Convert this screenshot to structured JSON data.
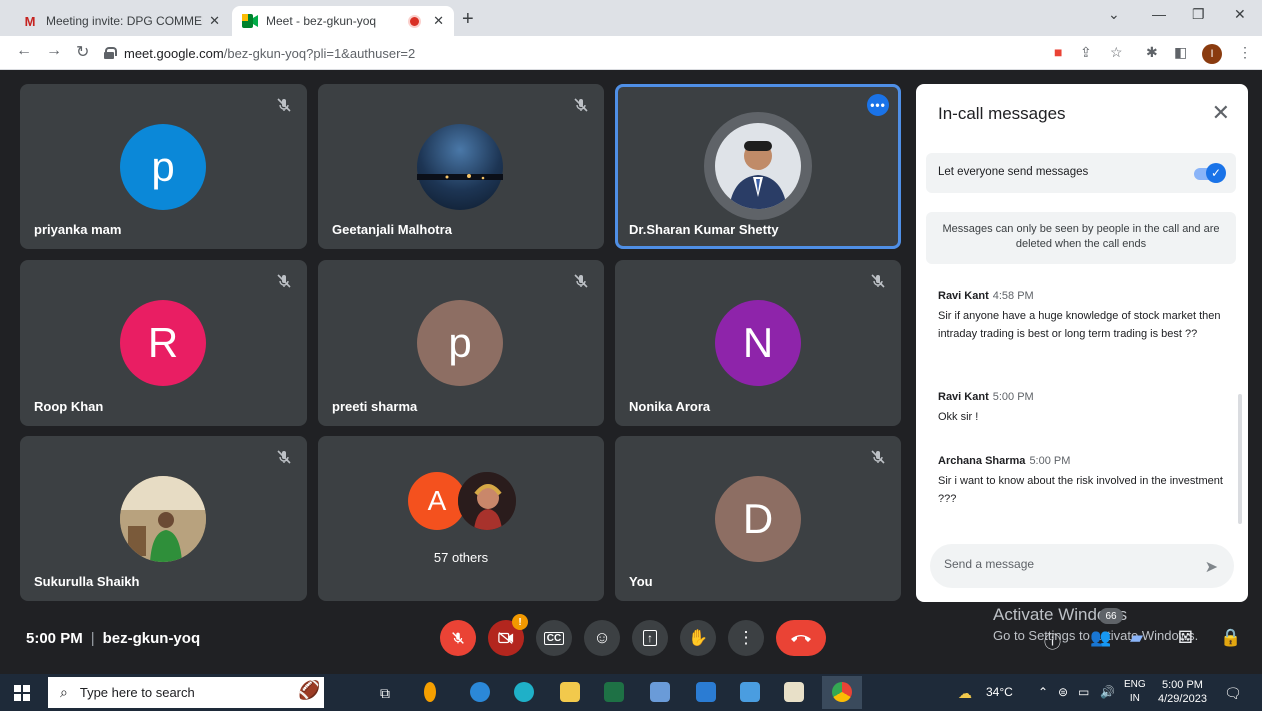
{
  "browser": {
    "tabs": [
      {
        "label": "Meeting invite: DPG COMMERCE",
        "favicon": "gmail-icon"
      },
      {
        "label": "Meet - bez-gkun-yoq",
        "favicon": "meet-icon"
      }
    ],
    "url_host": "meet.google.com",
    "url_path": "/bez-gkun-yoq?pli=1&authuser=2",
    "profile_initial": "I"
  },
  "participants": [
    {
      "name": "priyanka mam",
      "initial": "p",
      "color": "#0b88d8",
      "muted": true
    },
    {
      "name": "Geetanjali Malhotra",
      "initial": "",
      "color": "#2b4a6b",
      "muted": true
    },
    {
      "name": "Dr.Sharan Kumar Shetty",
      "initial": "",
      "color": "#8ca0b3",
      "muted": false,
      "active": true
    },
    {
      "name": "Roop Khan",
      "initial": "R",
      "color": "#e91e63",
      "muted": true
    },
    {
      "name": "preeti sharma",
      "initial": "p",
      "color": "#8d6e63",
      "muted": true
    },
    {
      "name": "Nonika Arora",
      "initial": "N",
      "color": "#8e24aa",
      "muted": true
    },
    {
      "name": "Sukurulla Shaikh",
      "initial": "",
      "color": "#8a7f62",
      "muted": true
    },
    {
      "name": "57 others",
      "initial": "A",
      "color": "#f4511e",
      "muted": false
    },
    {
      "name": "You",
      "initial": "D",
      "color": "#8d6e63",
      "muted": true
    }
  ],
  "chat": {
    "title": "In-call messages",
    "toggle_label": "Let everyone send messages",
    "notice": "Messages can only be seen by people in the call and are deleted when the call ends",
    "messages": [
      {
        "sender": "Ravi Kant",
        "time": "4:58 PM",
        "text": "Sir if anyone have a huge knowledge of stock market then intraday trading is best or long term trading is best ??"
      },
      {
        "sender": "Ravi Kant",
        "time": "5:00 PM",
        "text": "Okk sir !"
      },
      {
        "sender": "Archana Sharma",
        "time": "5:00 PM",
        "text": "Sir i want to know about the risk involved in the investment ???"
      }
    ],
    "input_placeholder": "Send a message"
  },
  "bottom_bar": {
    "time": "5:00 PM",
    "meeting_code": "bez-gkun-yoq",
    "camera_badge": "!",
    "participant_count": "66",
    "activate_line1": "Activate Windows",
    "activate_line2": "Go to Settings to activate Windows."
  },
  "taskbar": {
    "search_placeholder": "Type here to search",
    "weather": "34°C",
    "lang_line1": "ENG",
    "lang_line2": "IN",
    "time": "5:00 PM",
    "date": "4/29/2023"
  },
  "colors": {
    "meet_bg": "#202124",
    "tile_bg": "#3c4043",
    "accent_blue": "#1a73e8",
    "end_call_red": "#ea4335"
  }
}
